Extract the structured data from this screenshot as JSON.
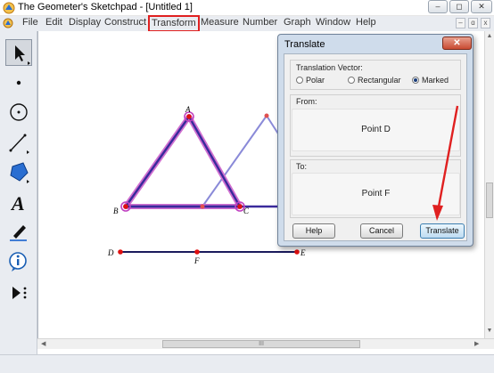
{
  "window": {
    "title": "The Geometer's Sketchpad - [Untitled 1]",
    "controls": [
      "–",
      "◻",
      "✕"
    ]
  },
  "menubar": {
    "items": [
      "File",
      "Edit",
      "Display",
      "Construct",
      "Transform",
      "Measure",
      "Number",
      "Graph",
      "Window",
      "Help"
    ],
    "highlighted": "Transform",
    "doc_controls": [
      "–",
      "ɑ",
      "x"
    ]
  },
  "toolbox": {
    "tools": [
      "arrow-tool",
      "point-tool",
      "compass-tool",
      "straightedge-tool",
      "polygon-tool",
      "text-tool",
      "marker-tool",
      "information-tool",
      "custom-tool"
    ],
    "text_tool_label": "A"
  },
  "sketch": {
    "point_labels": {
      "A": "A",
      "B": "B",
      "C": "C",
      "D": "D",
      "E": "E",
      "F": "F"
    },
    "colors": {
      "triangle": "#3a2a9c",
      "translated": "#8a8ad8",
      "selection": "#c040c0",
      "point": "#e01010",
      "vector": "#1a1a5c"
    }
  },
  "dialog": {
    "title": "Translate",
    "close": "✕",
    "vector_group_label": "Translation Vector:",
    "options": [
      "Polar",
      "Rectangular",
      "Marked"
    ],
    "selected_option": "Marked",
    "from_label": "From:",
    "from_value": "Point D",
    "to_label": "To:",
    "to_value": "Point F",
    "buttons": {
      "help": "Help",
      "cancel": "Cancel",
      "translate": "Translate"
    }
  },
  "annotation": {
    "arrow_color": "#e02020"
  },
  "scrollbar": {
    "hthumb": "III"
  }
}
